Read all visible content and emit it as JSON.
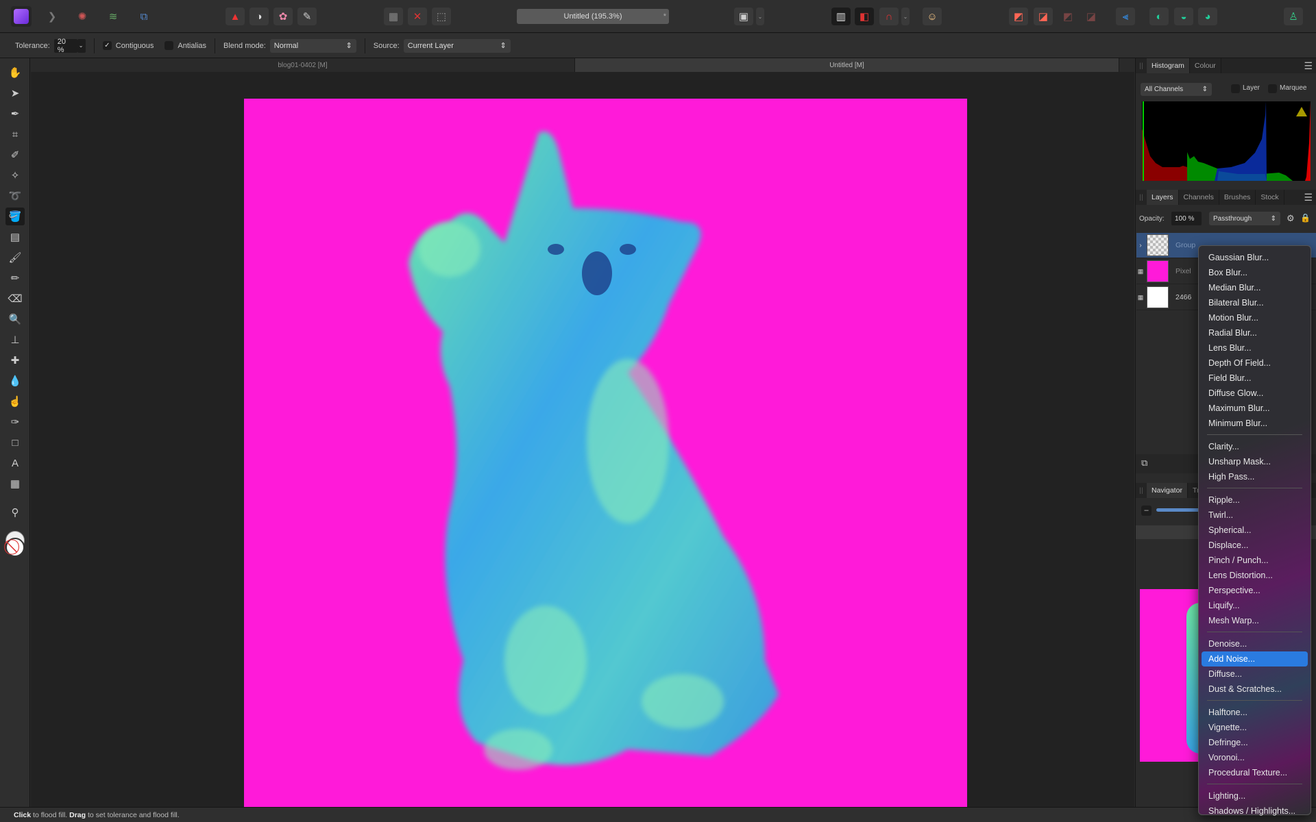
{
  "toolbar": {
    "document_title": "Untitled (195.3%)",
    "title_modified": "*",
    "persona_icons": [
      "photo-persona-icon",
      "liquify-persona-icon",
      "develop-persona-icon",
      "tone-mapping-persona-icon",
      "export-persona-icon"
    ],
    "accent": "#9b4dff"
  },
  "context": {
    "tolerance_label": "Tolerance:",
    "tolerance_value": "20 %",
    "contiguous_label": "Contiguous",
    "contiguous_checked": true,
    "antialias_label": "Antialias",
    "antialias_checked": false,
    "blend_label": "Blend mode:",
    "blend_value": "Normal",
    "source_label": "Source:",
    "source_value": "Current Layer"
  },
  "doc_tabs": [
    {
      "label": "blog01-0402 [M]",
      "active": false
    },
    {
      "label": "Untitled [M]",
      "active": true
    }
  ],
  "canvas": {
    "background_color": "#ff1ad9"
  },
  "status": {
    "b1": "Click",
    "t1": " to flood fill. ",
    "b2": "Drag",
    "t2": " to set tolerance and flood fill."
  },
  "histogram": {
    "tabs": [
      "Histogram",
      "Colour"
    ],
    "channel": "All Channels",
    "layer_label": "Layer",
    "marquee_label": "Marquee"
  },
  "layers": {
    "tabs": [
      "Layers",
      "Channels",
      "Brushes",
      "Stock"
    ],
    "opacity_label": "Opacity:",
    "opacity_value": "100 %",
    "blend_value": "Passthrough",
    "items": [
      {
        "name": "Group",
        "selected": true
      },
      {
        "name": "Pixel",
        "selected": false
      },
      {
        "name": "2466",
        "selected": false
      }
    ]
  },
  "navigator": {
    "tabs": [
      "Navigator",
      "Tr"
    ]
  },
  "menu": {
    "groups": [
      [
        "Gaussian Blur...",
        "Box Blur...",
        "Median Blur...",
        "Bilateral Blur...",
        "Motion Blur...",
        "Radial Blur...",
        "Lens Blur...",
        "Depth Of Field...",
        "Field Blur...",
        "Diffuse Glow...",
        "Maximum Blur...",
        "Minimum Blur..."
      ],
      [
        "Clarity...",
        "Unsharp Mask...",
        "High Pass..."
      ],
      [
        "Ripple...",
        "Twirl...",
        "Spherical...",
        "Displace...",
        "Pinch / Punch...",
        "Lens Distortion...",
        "Perspective...",
        "Liquify...",
        "Mesh Warp..."
      ],
      [
        "Denoise...",
        "Add Noise...",
        "Diffuse...",
        "Dust & Scratches..."
      ],
      [
        "Halftone...",
        "Vignette...",
        "Defringe...",
        "Voronoi...",
        "Procedural Texture..."
      ],
      [
        "Lighting...",
        "Shadows / Highlights..."
      ]
    ],
    "highlighted": "Add Noise...",
    "highlight_color": "#2a7be0"
  }
}
